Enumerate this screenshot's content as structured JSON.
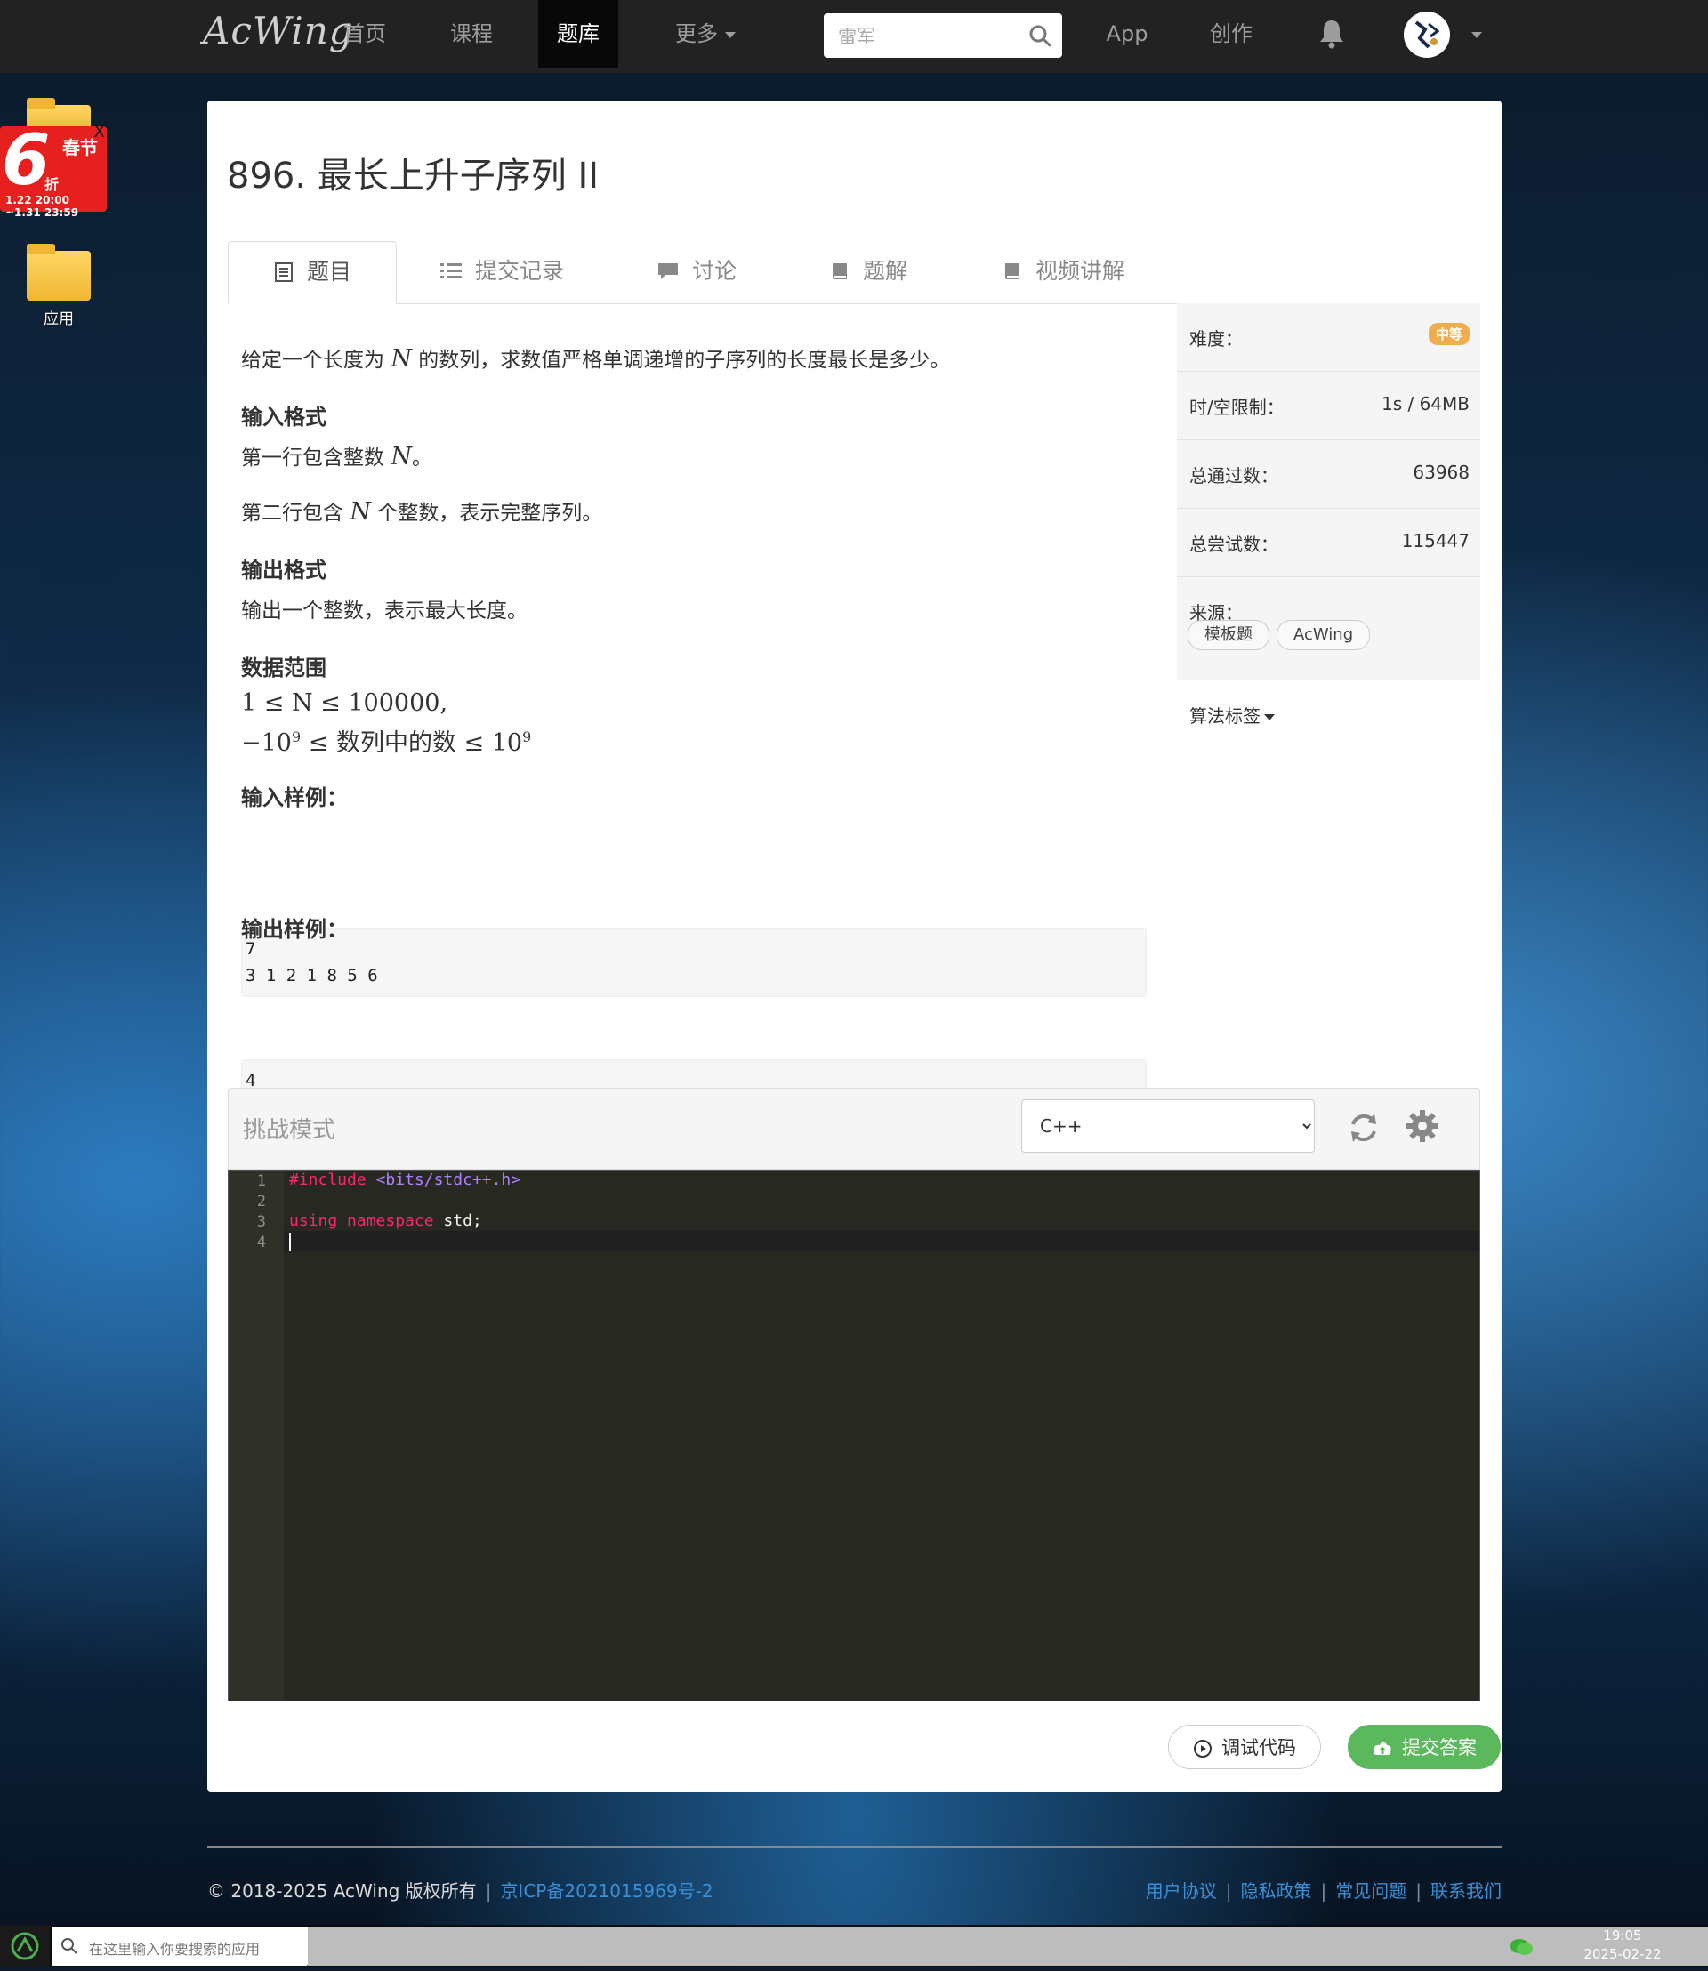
{
  "nav": {
    "logo": "AcWing",
    "items": [
      "首页",
      "课程",
      "题库",
      "更多"
    ],
    "active": "题库",
    "search_placeholder": "雷军",
    "app": "App",
    "create": "创作"
  },
  "desktop": {
    "promo": {
      "big": "6",
      "line1": "春节",
      "line2": "折",
      "line3": "1.22 20:00 ~1.31 23:59",
      "close": "X"
    },
    "folder_label": "应用"
  },
  "problem": {
    "title": "896. 最长上升子序列 II",
    "tabs": [
      "题目",
      "提交记录",
      "讨论",
      "题解",
      "视频讲解"
    ],
    "desc_pre": "给定一个长度为 ",
    "desc_var": "N",
    "desc_post": " 的数列，求数值严格单调递增的子序列的长度最长是多少。",
    "input_heading": "输入格式",
    "input_line1_pre": "第一行包含整数 ",
    "input_line1_var": "N",
    "input_line1_post": "。",
    "input_line2_pre": "第二行包含 ",
    "input_line2_var": "N",
    "input_line2_post": " 个整数，表示完整序列。",
    "output_heading": "输出格式",
    "output_text": "输出一个整数，表示最大长度。",
    "range_heading": "数据范围",
    "range_line1": "1 ≤ N ≤ 100000,",
    "range_line2_a": "−10",
    "range_line2_b": " ≤ 数列中的数 ≤ 10",
    "range_exp": "9",
    "sample_in_heading": "输入样例：",
    "sample_in": "7\n3 1 2 1 8 5 6",
    "sample_out_heading": "输出样例：",
    "sample_out": "4"
  },
  "side": {
    "difficulty_label": "难度：",
    "difficulty": "中等",
    "limit_label": "时/空限制：",
    "limit": "1s / 64MB",
    "passed_label": "总通过数：",
    "passed": "63968",
    "tried_label": "总尝试数：",
    "tried": "115447",
    "source_label": "来源：",
    "sources": [
      "模板题",
      "AcWing"
    ],
    "tags_label": "算法标签"
  },
  "editor": {
    "mode": "挑战模式",
    "language": "C++",
    "lines": [
      "1",
      "2",
      "3",
      "4"
    ],
    "code_include_kw": "#include",
    "code_include_lib": "<bits/stdc++.h>",
    "code_using": "using",
    "code_namespace": "namespace",
    "code_std": "std;",
    "debug_label": "调试代码",
    "submit_label": "提交答案"
  },
  "footer": {
    "copyright": "© 2018-2025 AcWing 版权所有",
    "icp": "京ICP备2021015969号-2",
    "links": [
      "用户协议",
      "隐私政策",
      "常见问题",
      "联系我们"
    ]
  },
  "taskbar": {
    "search_placeholder": "在这里输入你要搜索的应用",
    "time": "19:05",
    "date": "2025-02-22"
  },
  "colors": {
    "accent": "#5cb85c",
    "difficulty": "#f0ad4e",
    "nav_bg": "#222222",
    "link": "#3a8fd6"
  }
}
